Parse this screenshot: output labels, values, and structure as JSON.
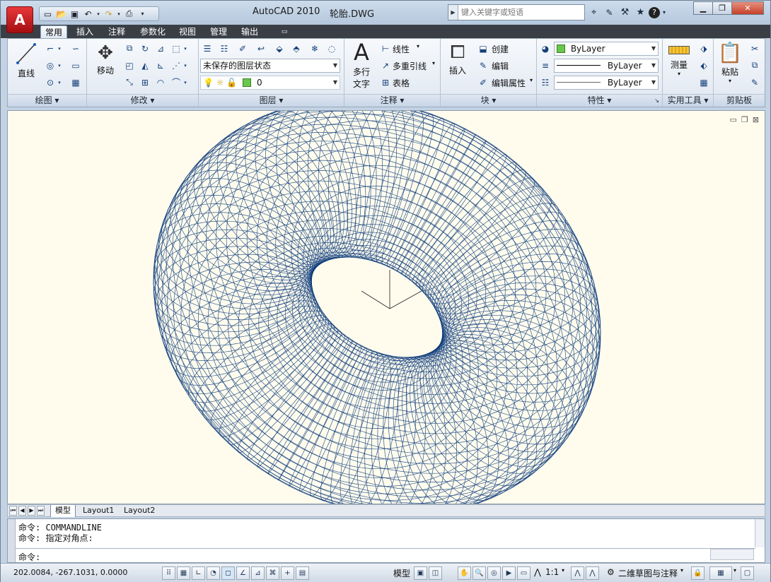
{
  "window": {
    "app_title": "AutoCAD 2010",
    "doc_name": "轮胎.DWG",
    "app_button": "A",
    "search_placeholder": "键入关键字或短语"
  },
  "ribbon_tabs": [
    {
      "label": "常用",
      "active": true
    },
    {
      "label": "插入"
    },
    {
      "label": "注释"
    },
    {
      "label": "参数化"
    },
    {
      "label": "视图"
    },
    {
      "label": "管理"
    },
    {
      "label": "输出"
    }
  ],
  "panels": {
    "draw": {
      "title": "绘图",
      "line": "直线"
    },
    "modify": {
      "title": "修改",
      "move": "移动"
    },
    "layers": {
      "title": "图层",
      "state": "未保存的图层状态",
      "current": "0"
    },
    "annotation": {
      "title": "注释",
      "mtext_line1": "多行",
      "mtext_line2": "文字",
      "linear": "线性",
      "mleader": "多重引线",
      "table": "表格"
    },
    "block": {
      "title": "块",
      "insert": "插入",
      "create": "创建",
      "edit": "编辑",
      "edit_attr": "编辑属性"
    },
    "properties": {
      "title": "特性",
      "color": "ByLayer",
      "linetype": "ByLayer",
      "lineweight": "ByLayer"
    },
    "utilities": {
      "title": "实用工具",
      "measure": "测量"
    },
    "clipboard": {
      "title": "剪贴板",
      "paste": "粘贴"
    }
  },
  "layout_tabs": [
    "模型",
    "Layout1",
    "Layout2"
  ],
  "command_lines": [
    "命令: COMMANDLINE",
    "命令: 指定对角点:",
    "命令:"
  ],
  "status": {
    "coords": "202.0084,  -267.1031, 0.0000",
    "model_label": "模型",
    "annotation_scale": "1:1",
    "workspace": "二维草图与注释"
  },
  "colors": {
    "wire": "#0d3b7a",
    "canvas": "#fffcee"
  }
}
